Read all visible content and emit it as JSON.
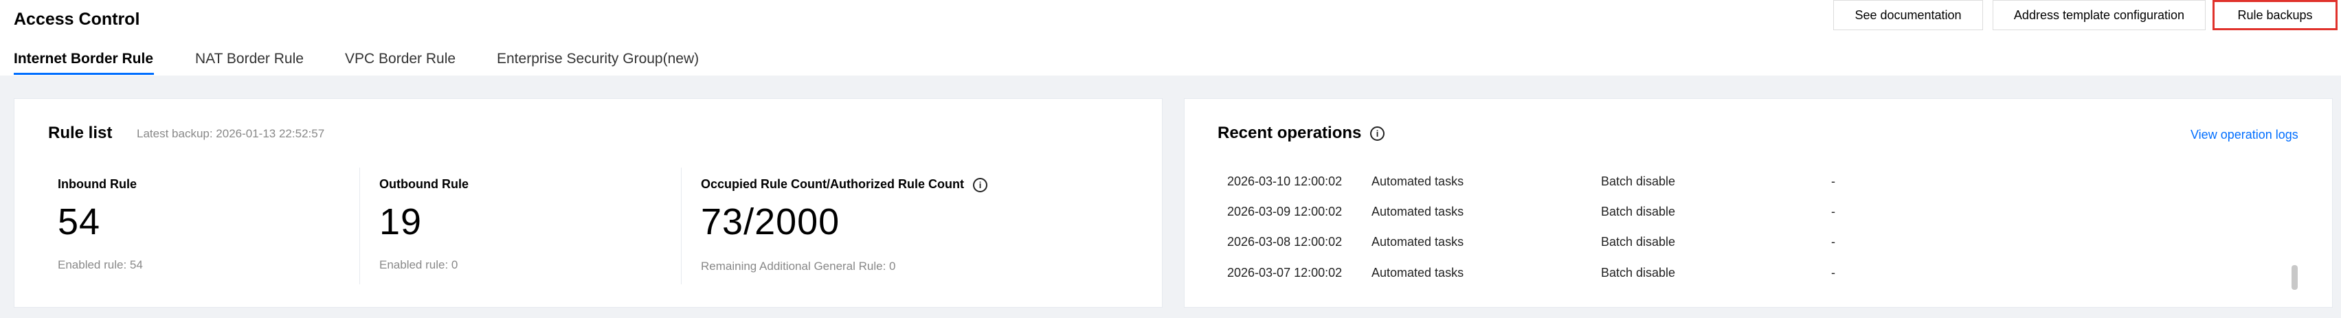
{
  "header": {
    "title": "Access Control",
    "actions": [
      {
        "label": "See documentation"
      },
      {
        "label": "Address template configuration"
      },
      {
        "label": "Rule backups"
      }
    ]
  },
  "tabs": [
    {
      "label": "Internet Border Rule",
      "active": true
    },
    {
      "label": "NAT Border Rule",
      "active": false
    },
    {
      "label": "VPC Border Rule",
      "active": false
    },
    {
      "label": "Enterprise Security Group(new)",
      "active": false
    }
  ],
  "rule_list": {
    "title": "Rule list",
    "latest_backup": "Latest backup: 2026-01-13 22:52:57",
    "stats": [
      {
        "label": "Inbound Rule",
        "value": "54",
        "sub": "Enabled rule: 54"
      },
      {
        "label": "Outbound Rule",
        "value": "19",
        "sub": "Enabled rule: 0"
      },
      {
        "label": "Occupied Rule Count/Authorized Rule Count",
        "value": "73/2000",
        "sub": "Remaining Additional General Rule: 0"
      }
    ]
  },
  "recent_ops": {
    "title": "Recent operations",
    "view_logs": "View operation logs",
    "rows": [
      {
        "time": "2026-03-10 12:00:02",
        "type": "Automated tasks",
        "action": "Batch disable",
        "detail": "-"
      },
      {
        "time": "2026-03-09 12:00:02",
        "type": "Automated tasks",
        "action": "Batch disable",
        "detail": "-"
      },
      {
        "time": "2026-03-08 12:00:02",
        "type": "Automated tasks",
        "action": "Batch disable",
        "detail": "-"
      },
      {
        "time": "2026-03-07 12:00:02",
        "type": "Automated tasks",
        "action": "Batch disable",
        "detail": "-"
      }
    ]
  },
  "icons": {
    "info": "info-circle-icon"
  },
  "colors": {
    "accent": "#006eff",
    "highlight_border": "#e0322c",
    "page_bg": "#f0f2f5"
  }
}
